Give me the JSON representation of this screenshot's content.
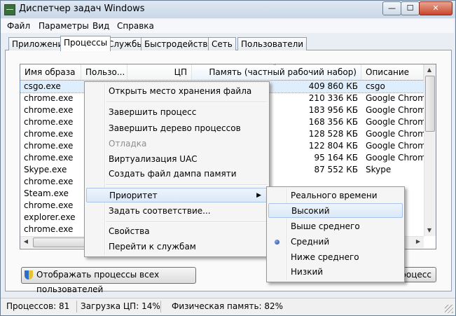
{
  "window": {
    "title": "Диспетчер задач Windows",
    "minimize": "—",
    "maximize": "☐",
    "close": "✕"
  },
  "menubar": [
    "Файл",
    "Параметры",
    "Вид",
    "Справка"
  ],
  "tabs": [
    "Приложения",
    "Процессы",
    "Службы",
    "Быстродействие",
    "Сеть",
    "Пользователи"
  ],
  "columns": {
    "image": "Имя образа",
    "user": "Пользо...",
    "cpu": "ЦП",
    "memory": "Память (частный рабочий набор)",
    "description": "Описание"
  },
  "processes": [
    {
      "image": "csgo.exe",
      "memory": "409 860 КБ",
      "description": "csgo"
    },
    {
      "image": "chrome.exe",
      "memory": "210 336 КБ",
      "description": "Google Chrome"
    },
    {
      "image": "chrome.exe",
      "memory": "183 956 КБ",
      "description": "Google Chrome"
    },
    {
      "image": "chrome.exe",
      "memory": "168 356 КБ",
      "description": "Google Chrome"
    },
    {
      "image": "chrome.exe",
      "memory": "128 528 КБ",
      "description": "Google Chrome"
    },
    {
      "image": "chrome.exe",
      "memory": "122 804 КБ",
      "description": "Google Chrome"
    },
    {
      "image": "chrome.exe",
      "memory": "95 164 КБ",
      "description": "Google Chrome"
    },
    {
      "image": "Skype.exe",
      "memory": "87 552 КБ",
      "description": "Skype"
    },
    {
      "image": "chrome.exe",
      "memory": "",
      "description": ""
    },
    {
      "image": "Steam.exe",
      "memory": "",
      "description": "t Boot"
    },
    {
      "image": "chrome.exe",
      "memory": "",
      "description": "ome"
    },
    {
      "image": "explorer.exe",
      "memory": "",
      "description": ""
    },
    {
      "image": "chrome.exe",
      "memory": "",
      "description": "ome"
    },
    {
      "image": "chrome.exe",
      "memory": "",
      "description": "ome"
    }
  ],
  "buttons": {
    "show_all": "Отображать процессы всех пользователей",
    "end_process": "роцесс"
  },
  "status": {
    "processes": "Процессов: 81",
    "cpu": "Загрузка ЦП: 14%",
    "memory": "Физическая память: 82%"
  },
  "context_menu": {
    "open_location": "Открыть место хранения файла",
    "end_process": "Завершить процесс",
    "end_tree": "Завершить дерево процессов",
    "debug": "Отладка",
    "uac": "Виртуализация UAC",
    "dump": "Создать файл дампа памяти",
    "priority": "Приоритет",
    "affinity": "Задать соответствие...",
    "properties": "Свойства",
    "goto_services": "Перейти к службам"
  },
  "priority_menu": [
    "Реального времени",
    "Высокий",
    "Выше среднего",
    "Средний",
    "Ниже среднего",
    "Низкий"
  ],
  "priority_selected": "Средний",
  "priority_hovered": "Высокий"
}
